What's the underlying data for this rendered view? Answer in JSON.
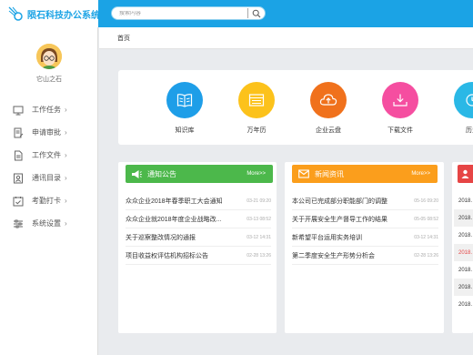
{
  "app": {
    "title": "陨石科技办公系统"
  },
  "search": {
    "placeholder": "搜索内容"
  },
  "user": {
    "name": "它山之石"
  },
  "sidebar": {
    "items": [
      {
        "label": "工作任务",
        "icon": "monitor-icon"
      },
      {
        "label": "申请审批",
        "icon": "document-edit-icon"
      },
      {
        "label": "工作文件",
        "icon": "file-icon"
      },
      {
        "label": "通讯目录",
        "icon": "contacts-icon"
      },
      {
        "label": "考勤打卡",
        "icon": "calendar-check-icon"
      },
      {
        "label": "系统设置",
        "icon": "sliders-icon"
      }
    ],
    "chevron": "›"
  },
  "breadcrumb": {
    "current": "首页"
  },
  "apps": [
    {
      "label": "知识库",
      "color": "#1e9ee8",
      "icon": "book-icon"
    },
    {
      "label": "万年历",
      "color": "#fcc21b",
      "icon": "calendar-icon"
    },
    {
      "label": "企业云盘",
      "color": "#f0711c",
      "icon": "cloud-upload-icon"
    },
    {
      "label": "下载文件",
      "color": "#f54ea0",
      "icon": "download-icon"
    },
    {
      "label": "历史",
      "color": "#2ab8e6",
      "icon": "history-icon"
    }
  ],
  "cards": {
    "notice": {
      "title": "通知公告",
      "more": "More>>",
      "color": "#4cb84b",
      "icon": "megaphone-icon",
      "rows": [
        {
          "title": "众众企业2018年春季职工大会通知",
          "date": "03-21 09:20"
        },
        {
          "title": "众众企业就2018年度企业战略改...",
          "date": "03-13 08:52"
        },
        {
          "title": "关于巡察整改情况的通报",
          "date": "03-12 14:31"
        },
        {
          "title": "项目收益权评估机构招标公告",
          "date": "02-28 13:26"
        }
      ]
    },
    "news": {
      "title": "新闻资讯",
      "more": "More>>",
      "color": "#fb9e1c",
      "icon": "envelope-icon",
      "rows": [
        {
          "title": "本公司已完成部分职能部门的调整",
          "date": "05-16 09:20"
        },
        {
          "title": "关于开展安全生产督导工作的结果",
          "date": "05-05 08:52"
        },
        {
          "title": "新希望平台运用实务培训",
          "date": "03-12 14:31"
        },
        {
          "title": "第二季度安全生产形势分析会",
          "date": "02-28 13:26"
        }
      ]
    },
    "third": {
      "color": "#e64545",
      "icon": "person-icon",
      "rows": [
        "2018.",
        "2018.",
        "2018.",
        "2018.",
        "2018.",
        "2018.",
        "2018."
      ]
    }
  }
}
